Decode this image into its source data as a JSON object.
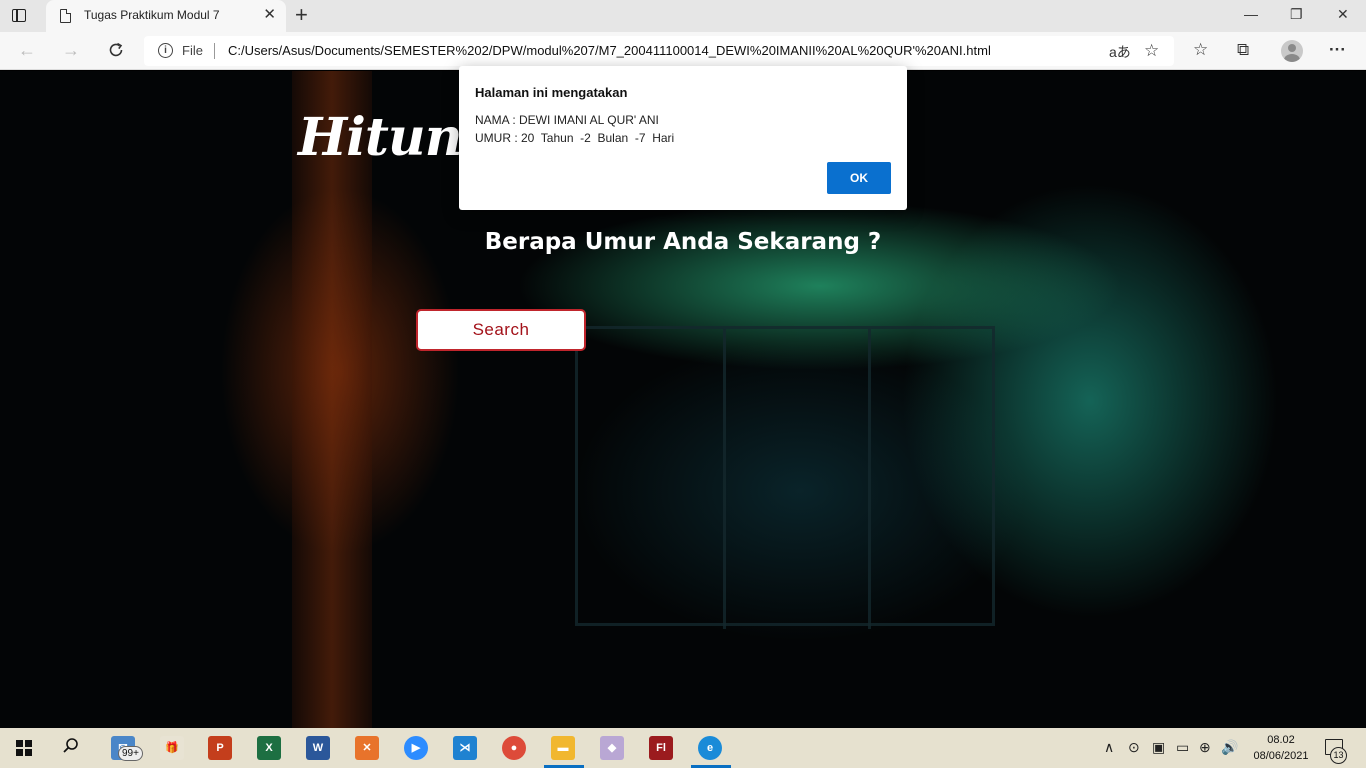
{
  "browser": {
    "tab_title": "Tugas Praktikum Modul 7",
    "tab_close": "✕",
    "new_tab": "+",
    "window_controls": {
      "minimize": "—",
      "restore": "❐",
      "close": "✕"
    },
    "nav": {
      "back": "←",
      "forward": "→"
    },
    "address": {
      "scheme_label": "File",
      "url": "C:/Users/Asus/Documents/SEMESTER%202/DPW/modul%207/M7_200411100014_DEWI%20IMANII%20AL%20QUR'%20ANI.html",
      "read_aloud": "aあ",
      "add_favorite": "☆"
    },
    "toolbar_icons": {
      "favorites": "☆",
      "collections": "⧉",
      "menu": "···"
    }
  },
  "page": {
    "hero_title": "Hitung                          Mudah",
    "subtitle": "Berapa Umur Anda Sekarang ?",
    "search_button": "Search"
  },
  "dialog": {
    "heading": "Halaman ini mengatakan",
    "line1": "NAMA : DEWI IMANI AL QUR' ANI",
    "line2": "UMUR : 20  Tahun  -2  Bulan  -7  Hari",
    "ok_label": "OK"
  },
  "taskbar": {
    "mail_badge": "99+",
    "apps": [
      {
        "name": "powerpoint",
        "glyph": "P",
        "color": "#c43e1c"
      },
      {
        "name": "excel",
        "glyph": "X",
        "color": "#1d6f42"
      },
      {
        "name": "word",
        "glyph": "W",
        "color": "#2b579a"
      },
      {
        "name": "xampp",
        "glyph": "✕",
        "color": "#e8732b"
      },
      {
        "name": "zoom",
        "glyph": "▶",
        "color": "#2d8cff"
      },
      {
        "name": "vscode",
        "glyph": "⋊",
        "color": "#1f82d1"
      },
      {
        "name": "chrome",
        "glyph": "●",
        "color": "#dd4b39"
      },
      {
        "name": "file-explorer",
        "glyph": "▬",
        "color": "#f1b72f"
      },
      {
        "name": "paint",
        "glyph": "◆",
        "color": "#b9a7d4"
      },
      {
        "name": "flash",
        "glyph": "Fl",
        "color": "#9b1b1e"
      },
      {
        "name": "edge",
        "glyph": "e",
        "color": "#1a8bd8"
      }
    ],
    "tray": {
      "chevron": "∧",
      "volume": "🔊"
    },
    "time": "08.02",
    "date": "08/06/2021",
    "notification_count": "13"
  }
}
